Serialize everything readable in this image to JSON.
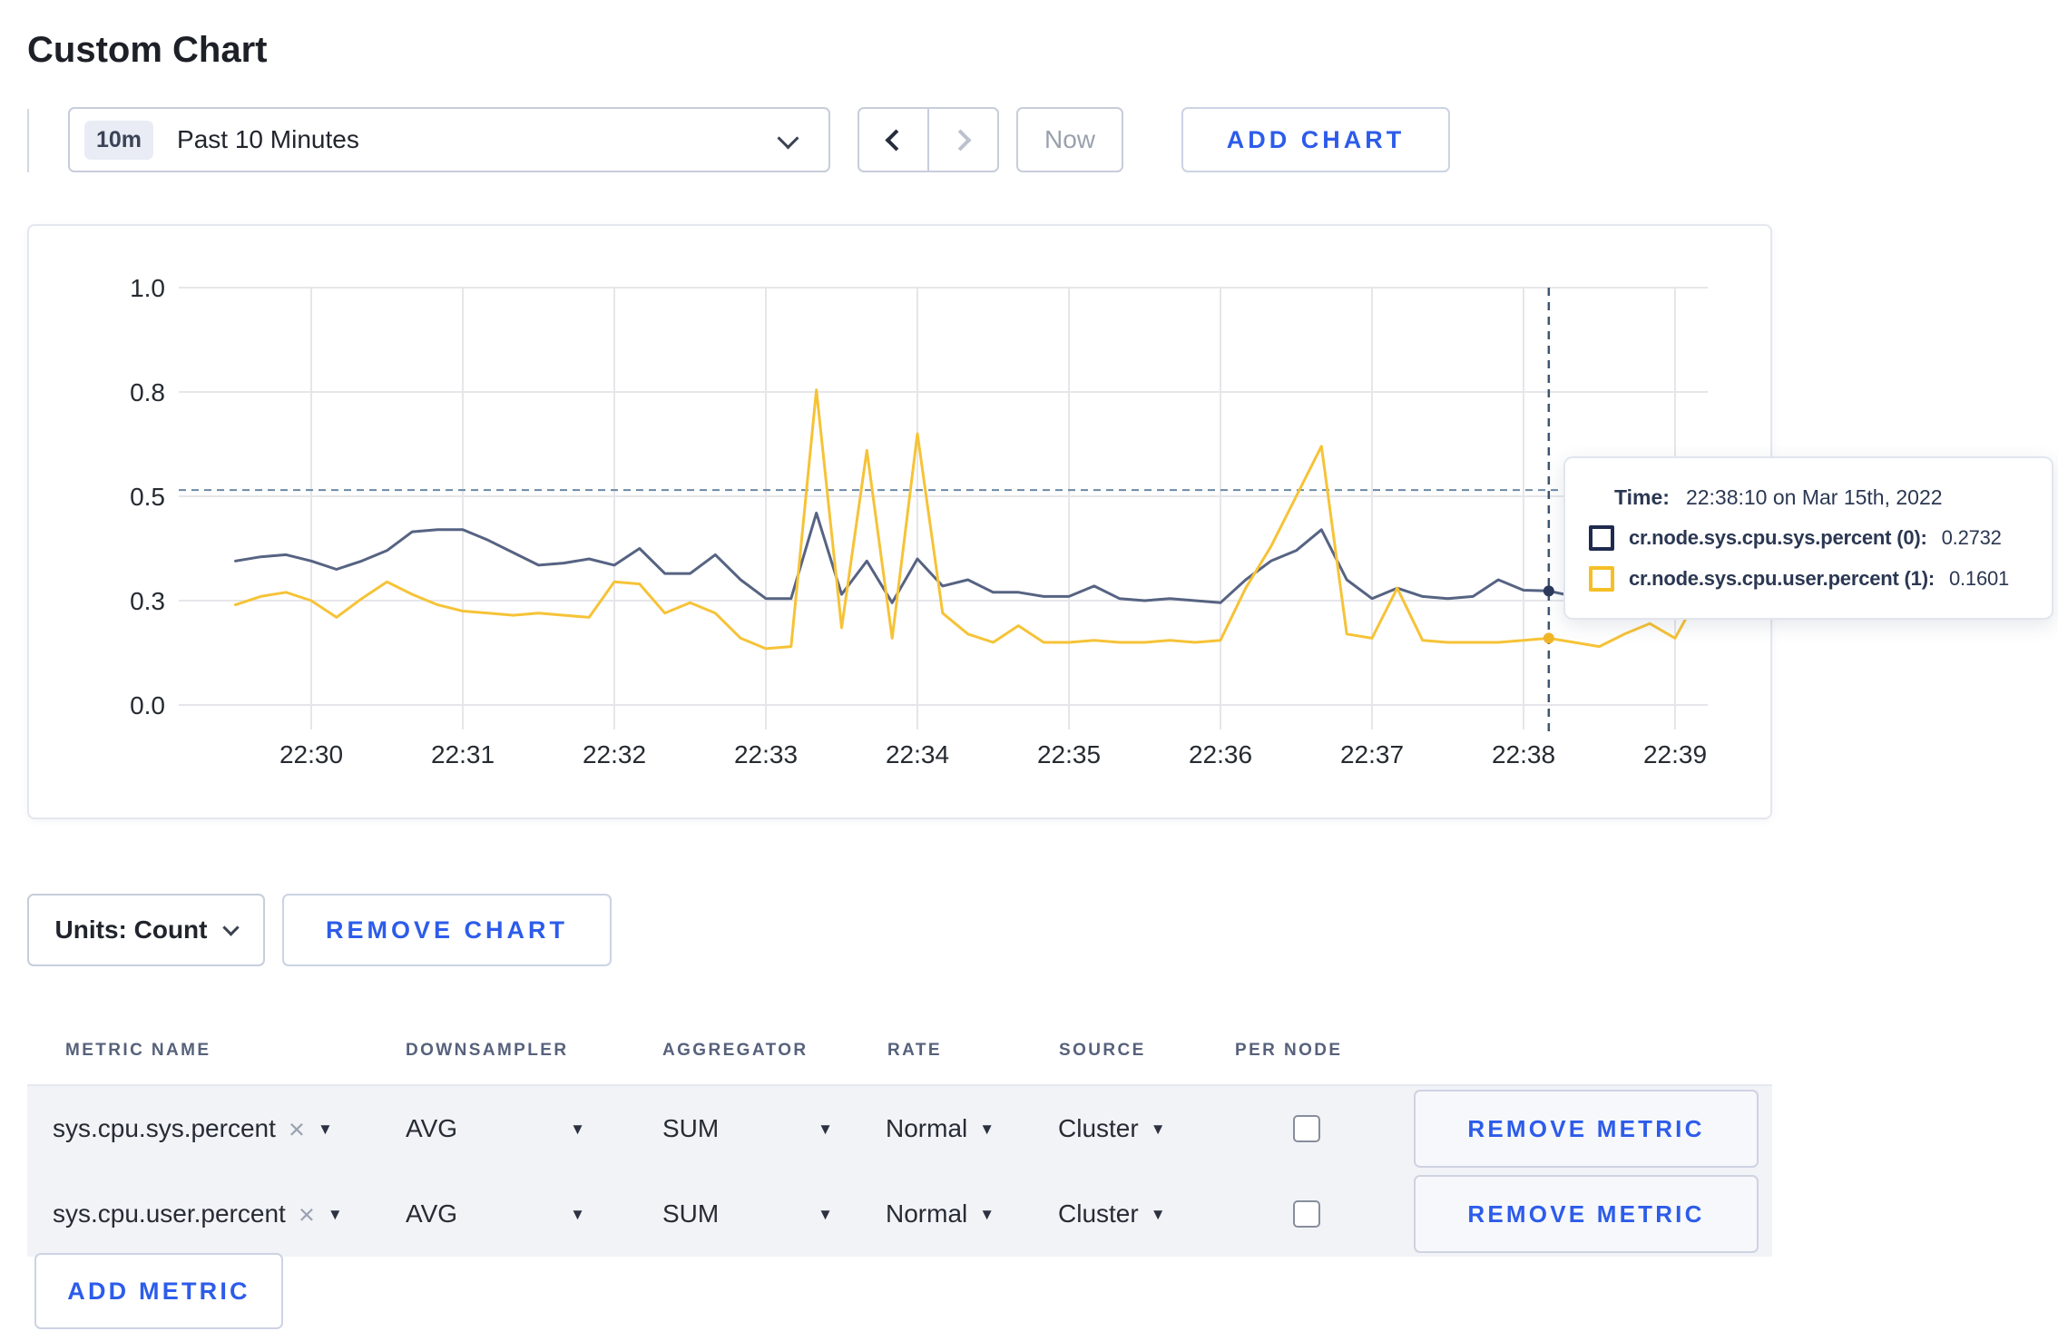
{
  "page": {
    "title": "Custom Chart"
  },
  "toolbar": {
    "time_badge": "10m",
    "time_label": "Past 10 Minutes",
    "now_label": "Now",
    "add_chart_label": "ADD CHART"
  },
  "icons": {
    "clear": "×",
    "caret": "▼"
  },
  "chart_data": {
    "type": "line",
    "title": "",
    "xlabel": "",
    "ylabel": "",
    "ylim": [
      0,
      1
    ],
    "y_tick_values": [
      0,
      0.25,
      0.5,
      0.75,
      1.0
    ],
    "y_tick_labels": [
      "0.0",
      "0.3",
      "0.5",
      "0.8",
      "1.0"
    ],
    "x_tick_labels": [
      "22:30",
      "22:31",
      "22:32",
      "22:33",
      "22:34",
      "22:35",
      "22:36",
      "22:37",
      "22:38",
      "22:39"
    ],
    "x_start_label": "22:29:30",
    "x_interval_seconds": 10,
    "grid": true,
    "legend_position": "tooltip",
    "colors": {
      "grid": "#e6e6ea",
      "axis_text": "#262a31",
      "crosshair_h": "#6b89a6",
      "crosshair_v": "#3d556f"
    },
    "series": [
      {
        "name": "cr.node.sys.cpu.sys.percent (0)",
        "color": "#566382",
        "dot_color": "#2c3a5c",
        "values": [
          0.345,
          0.355,
          0.36,
          0.345,
          0.325,
          0.345,
          0.37,
          0.415,
          0.42,
          0.42,
          0.395,
          0.365,
          0.335,
          0.34,
          0.35,
          0.335,
          0.375,
          0.315,
          0.315,
          0.36,
          0.3,
          0.255,
          0.255,
          0.46,
          0.265,
          0.345,
          0.245,
          0.35,
          0.285,
          0.3,
          0.27,
          0.27,
          0.26,
          0.26,
          0.285,
          0.255,
          0.25,
          0.255,
          0.25,
          0.245,
          0.3,
          0.345,
          0.37,
          0.42,
          0.3,
          0.255,
          0.28,
          0.26,
          0.255,
          0.26,
          0.3,
          0.275,
          0.2732,
          0.26,
          0.28,
          0.31,
          0.3,
          0.3,
          0.295
        ]
      },
      {
        "name": "cr.node.sys.cpu.user.percent (1)",
        "color": "#f6c337",
        "dot_color": "#f0b429",
        "values": [
          0.24,
          0.26,
          0.27,
          0.25,
          0.21,
          0.255,
          0.295,
          0.265,
          0.24,
          0.225,
          0.22,
          0.215,
          0.22,
          0.215,
          0.21,
          0.295,
          0.29,
          0.22,
          0.245,
          0.22,
          0.16,
          0.135,
          0.14,
          0.755,
          0.185,
          0.61,
          0.16,
          0.65,
          0.22,
          0.17,
          0.15,
          0.19,
          0.15,
          0.15,
          0.155,
          0.15,
          0.15,
          0.155,
          0.15,
          0.155,
          0.28,
          0.38,
          0.5,
          0.62,
          0.17,
          0.16,
          0.28,
          0.155,
          0.15,
          0.15,
          0.15,
          0.155,
          0.1601,
          0.15,
          0.14,
          0.17,
          0.195,
          0.16,
          0.27
        ]
      }
    ],
    "hover": {
      "index": 52,
      "time": "22:38:10",
      "guide_value": 0.515
    }
  },
  "tooltip": {
    "time_label": "Time:",
    "time_value": "22:38:10 on Mar 15th, 2022",
    "rows": [
      {
        "label": "cr.node.sys.cpu.sys.percent (0):",
        "value": "0.2732",
        "color": "#1f2b4e"
      },
      {
        "label": "cr.node.sys.cpu.user.percent (1):",
        "value": "0.1601",
        "color": "#f5bf25"
      }
    ]
  },
  "units": {
    "label": "Units: Count"
  },
  "chart_actions": {
    "remove_chart_label": "REMOVE CHART"
  },
  "metrics_table": {
    "headers": [
      "METRIC NAME",
      "DOWNSAMPLER",
      "AGGREGATOR",
      "RATE",
      "SOURCE",
      "PER NODE"
    ],
    "rows": [
      {
        "metric_name": "sys.cpu.sys.percent",
        "downsampler": "AVG",
        "aggregator": "SUM",
        "rate": "Normal",
        "source": "Cluster",
        "per_node_checked": false,
        "remove_metric_label": "REMOVE METRIC"
      },
      {
        "metric_name": "sys.cpu.user.percent",
        "downsampler": "AVG",
        "aggregator": "SUM",
        "rate": "Normal",
        "source": "Cluster",
        "per_node_checked": false,
        "remove_metric_label": "REMOVE METRIC"
      }
    ],
    "add_metric_label": "ADD METRIC"
  },
  "accent_color": "#2d5cea"
}
